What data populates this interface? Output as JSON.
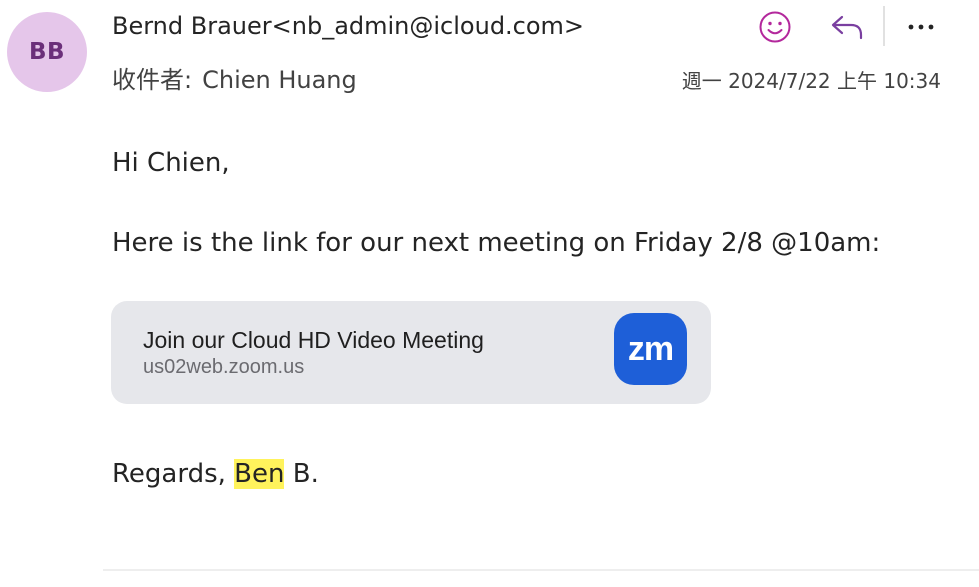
{
  "header": {
    "avatar_initials": "BB",
    "sender": "Bernd Brauer<nb_admin@icloud.com>",
    "to_label": "收件者:",
    "recipient": "Chien Huang",
    "timestamp": "週一 2024/7/22 上午 10:34"
  },
  "actions": {
    "emoji_icon": "smiley-icon",
    "reply_icon": "reply-icon",
    "more_icon": "more-icon"
  },
  "body": {
    "greeting": "Hi Chien,",
    "message": "Here is the link for our next meeting on Friday 2/8 @10am:",
    "link_card": {
      "title": "Join our Cloud HD Video Meeting",
      "url": "us02web.zoom.us",
      "logo_text": "zm"
    },
    "closing": {
      "prefix": "Regards, ",
      "highlighted": "Ben",
      "suffix": " B."
    }
  },
  "colors": {
    "avatar_bg": "#e5c6ea",
    "avatar_text": "#6b2f7a",
    "accent_icon": "#b3289c",
    "reply_icon": "#7a3fa0",
    "highlight": "#fff35c",
    "zoom_blue": "#1e5fd8",
    "card_bg": "#e6e7eb"
  }
}
